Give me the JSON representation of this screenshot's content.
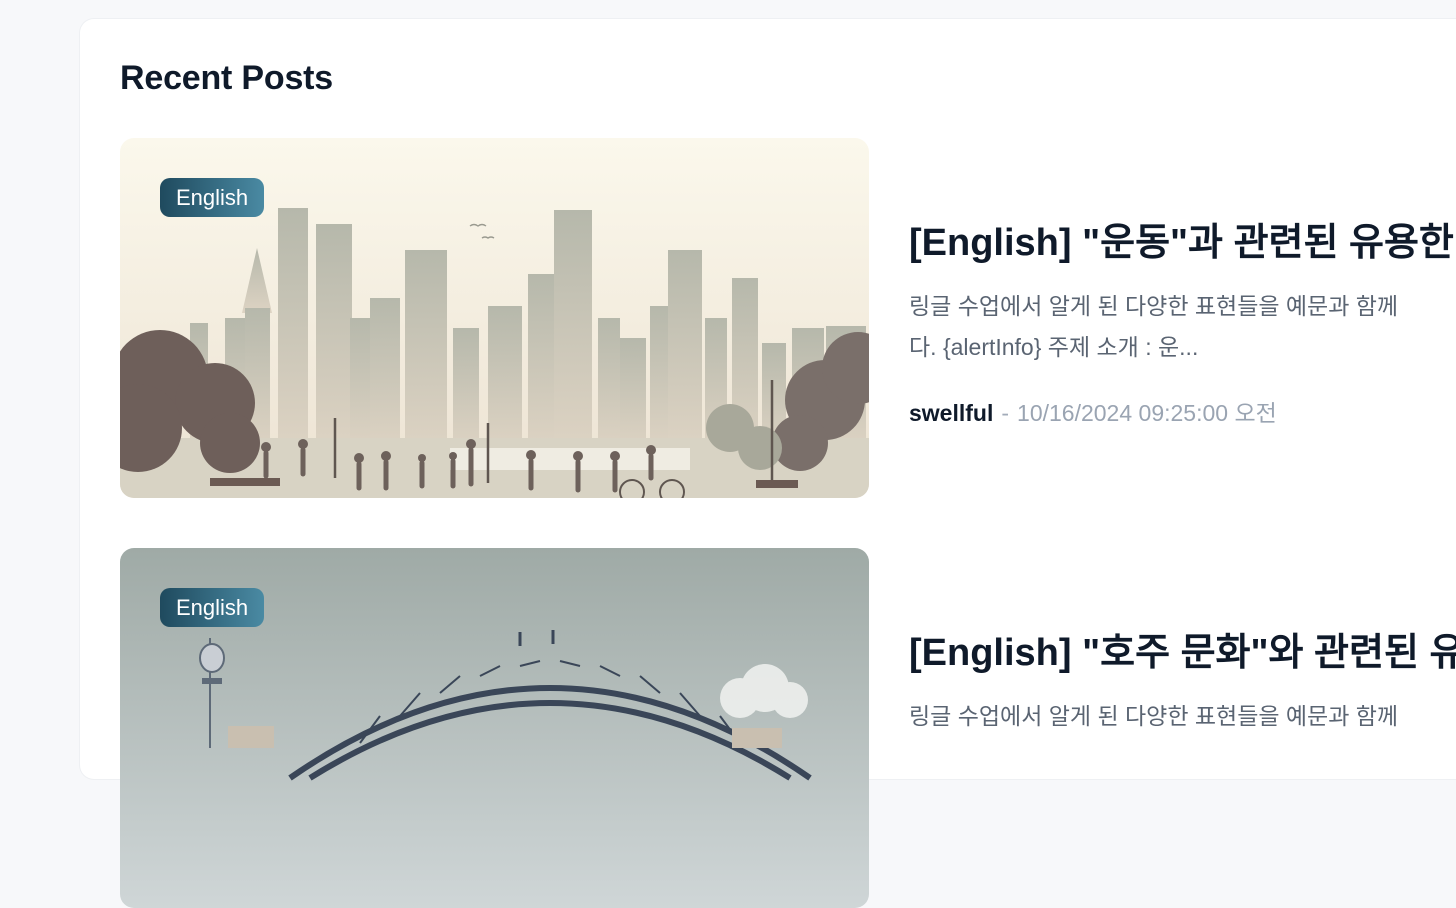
{
  "section": {
    "title": "Recent Posts"
  },
  "posts": [
    {
      "badge": "English",
      "title": "[English] \"운동\"과 관련된 유용한",
      "excerpt_line1": "링글 수업에서 알게 된 다양한 표현들을 예문과 함께",
      "excerpt_line2": "다. {alertInfo} 주제 소개 : 운...",
      "author": "swellful",
      "separator": "-",
      "date": "10/16/2024 09:25:00 오전",
      "image": "city-park-running-illustration"
    },
    {
      "badge": "English",
      "title": "[English] \"호주 문화\"와 관련된 유",
      "excerpt_line1": "링글 수업에서 알게 된 다양한 표현들을 예문과 함께",
      "image": "sydney-harbour-bridge-illustration"
    }
  ],
  "colors": {
    "accent_badge_start": "#1f4a5e",
    "accent_badge_end": "#4a8aa3",
    "title": "#0f1a2a",
    "muted": "#9aa4b2"
  }
}
